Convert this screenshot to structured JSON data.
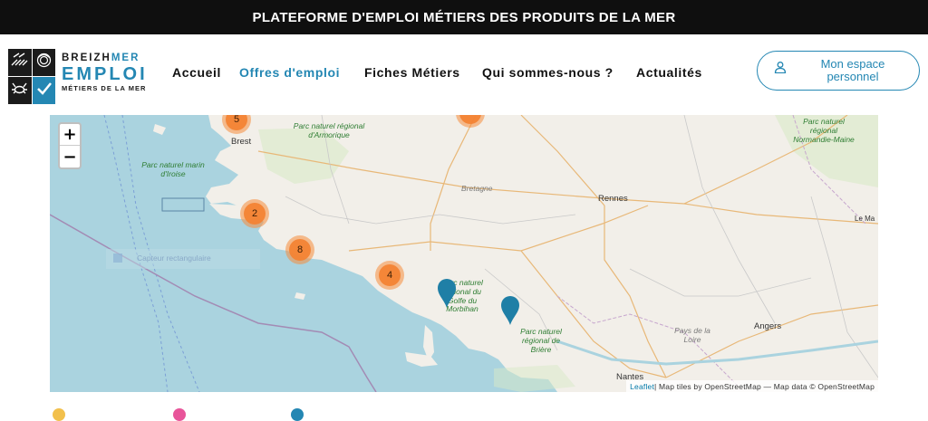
{
  "topbar": {
    "title": "PLATEFORME D'EMPLOI MÉTIERS DES PRODUITS DE LA MER"
  },
  "logo": {
    "line1_a": "BREIZH",
    "line1_b": "MER",
    "line2": "EMPLOI",
    "line3": "MÉTIERS DE LA MER"
  },
  "nav": {
    "items": [
      {
        "label": "Accueil"
      },
      {
        "label": "Offres d'emploi"
      },
      {
        "label": "Fiches Métiers"
      },
      {
        "label": "Qui sommes-nous ?"
      },
      {
        "label": "Actualités"
      }
    ],
    "account_button": "Mon espace personnel"
  },
  "map": {
    "zoom_in": "+",
    "zoom_out": "−",
    "clusters": [
      {
        "count": "5"
      },
      {
        "count": "2"
      },
      {
        "count": "8"
      },
      {
        "count": "4"
      }
    ],
    "labels": {
      "brest": "Brest",
      "armorique": "Parc naturel régional d'Armorique",
      "iroise": "Parc naturel marin d'Iroise",
      "bretagne": "Bretagne",
      "rennes": "Rennes",
      "normandie": "Parc naturel régional Normandie-Maine",
      "lemans": "Le Ma",
      "capteur": "Capteur rectangulaire",
      "morbihan": "Parc naturel régional du Golfe du Morbihan",
      "briere": "Parc naturel régional de Brière",
      "pays_loire": "Pays de la Loire",
      "angers": "Angers",
      "nantes": "Nantes"
    },
    "attribution_link": "Leaflet",
    "attribution_text": " | Map tiles by OpenStreetMap — Map data © OpenStreetMap"
  },
  "colors": {
    "accent": "#2487b3",
    "cluster": "#f38334",
    "marker": "#1f7fa6",
    "topbar": "#0f0f0f",
    "sea": "#aad3df",
    "land": "#f2efe9"
  }
}
